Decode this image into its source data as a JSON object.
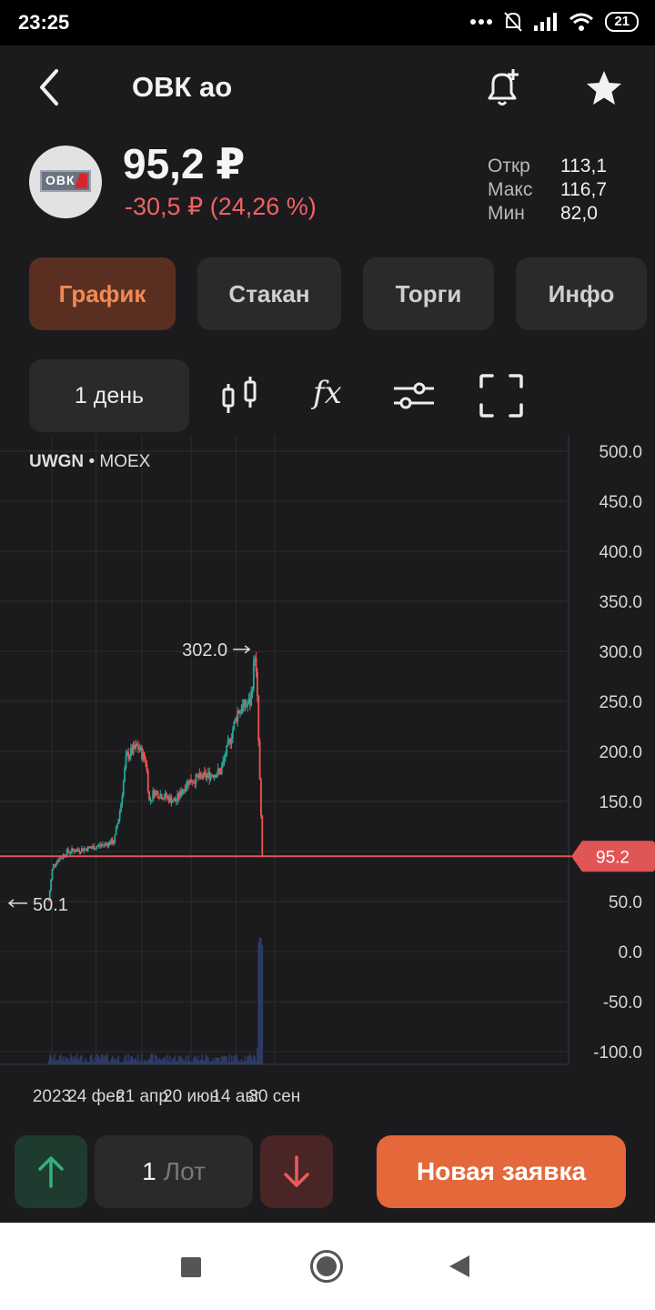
{
  "status_bar": {
    "time": "23:25",
    "battery": "21"
  },
  "header": {
    "title": "ОВК ао"
  },
  "logo": {
    "text": "ОВК"
  },
  "quote": {
    "price": "95,2 ₽",
    "change": "-30,5 ₽ (24,26 %)",
    "stats": [
      {
        "label": "Откр",
        "value": "113,1"
      },
      {
        "label": "Макс",
        "value": "116,7"
      },
      {
        "label": "Мин",
        "value": "82,0"
      }
    ]
  },
  "tabs": [
    {
      "label": "График",
      "active": true
    },
    {
      "label": "Стакан",
      "active": false
    },
    {
      "label": "Торги",
      "active": false
    },
    {
      "label": "Инфо",
      "active": false
    }
  ],
  "toolbar": {
    "period": "1 день",
    "fx_label": "fx"
  },
  "chart_ticker": {
    "symbol": "UWGN",
    "separator": "•",
    "exchange": "MOEX"
  },
  "chart_data": {
    "type": "candlestick",
    "y_ticks": [
      "500.0",
      "450.0",
      "400.0",
      "350.0",
      "300.0",
      "250.0",
      "200.0",
      "150.0",
      "50.0",
      "0.0",
      "-50.0",
      "-100.0"
    ],
    "x_ticks": [
      "2023",
      "24 фев",
      "21 апр",
      "20 июн",
      "14 авг",
      "30 сен"
    ],
    "ylim": [
      -100,
      500
    ],
    "max_label": "302.0",
    "max_value": 302.0,
    "min_label": "50.1",
    "min_value": 50.1,
    "current_price_label": "95.2",
    "current_price": 95.2,
    "colors": {
      "up": "#26a69a",
      "down": "#ef5350",
      "volume": "#2c3a66",
      "price_line": "#e05555"
    },
    "close_trajectory": [
      {
        "x": "2022-12-28",
        "y": 51
      },
      {
        "x": "2023-01-02",
        "y": 85
      },
      {
        "x": "2023-01-06",
        "y": 90
      },
      {
        "x": "2023-01-20",
        "y": 100
      },
      {
        "x": "2023-02-20",
        "y": 104
      },
      {
        "x": "2023-03-18",
        "y": 110
      },
      {
        "x": "2023-03-26",
        "y": 145
      },
      {
        "x": "2023-04-02",
        "y": 195
      },
      {
        "x": "2023-04-16",
        "y": 205
      },
      {
        "x": "2023-04-26",
        "y": 190
      },
      {
        "x": "2023-04-30",
        "y": 150
      },
      {
        "x": "2023-05-06",
        "y": 160
      },
      {
        "x": "2023-06-01",
        "y": 150
      },
      {
        "x": "2023-06-16",
        "y": 170
      },
      {
        "x": "2023-07-26",
        "y": 180
      },
      {
        "x": "2023-08-06",
        "y": 210
      },
      {
        "x": "2023-08-16",
        "y": 240
      },
      {
        "x": "2023-09-01",
        "y": 250
      },
      {
        "x": "2023-09-06",
        "y": 300
      },
      {
        "x": "2023-09-09",
        "y": 250
      },
      {
        "x": "2023-09-12",
        "y": 170
      },
      {
        "x": "2023-09-15",
        "y": 95
      }
    ]
  },
  "bottom_bar": {
    "lot_count": "1",
    "lot_unit": "Лот",
    "order_button": "Новая заявка"
  }
}
